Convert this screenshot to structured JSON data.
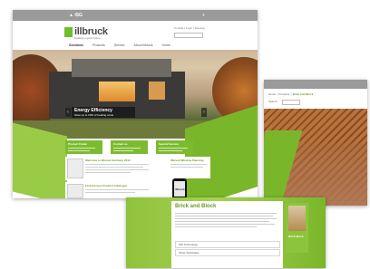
{
  "main": {
    "topbar": {
      "brand": "▲ ISG",
      "plus": "+"
    },
    "logo": {
      "name": "illbruck",
      "tagline": "building a good future"
    },
    "util": {
      "text": "Contact  |  Login  |  Sitemap"
    },
    "nav": [
      "Solutions",
      "Products",
      "Service",
      "About illbruck",
      "Home"
    ],
    "hero": {
      "title": "Energy Efficiency",
      "subtitle": "Save up to 20% of heating costs",
      "prev": "‹",
      "next": "›"
    },
    "tiles": [
      {
        "title": "Product Finder"
      },
      {
        "title": "Contact us"
      },
      {
        "title": "Special Service"
      }
    ],
    "cards": {
      "left_title": "Welcome to illbruck Germany 2012",
      "right_title": "illbruck Window Planning",
      "bottom_title": "Find the best Product Catalogue",
      "phone_label": "illbruck"
    }
  },
  "right": {
    "nav_prefix": "Home > Products > ",
    "nav_current": "Brick and Block",
    "search_label": "Search"
  },
  "bottom": {
    "title": "Brick and Block",
    "accordion": [
      "HW Technology",
      "Other Substrates"
    ],
    "side_caption": "Brick Block"
  },
  "colors": {
    "green": "#7ab62a",
    "gray_bar": "#9a9a9a",
    "accent_text": "#6b9a25"
  }
}
